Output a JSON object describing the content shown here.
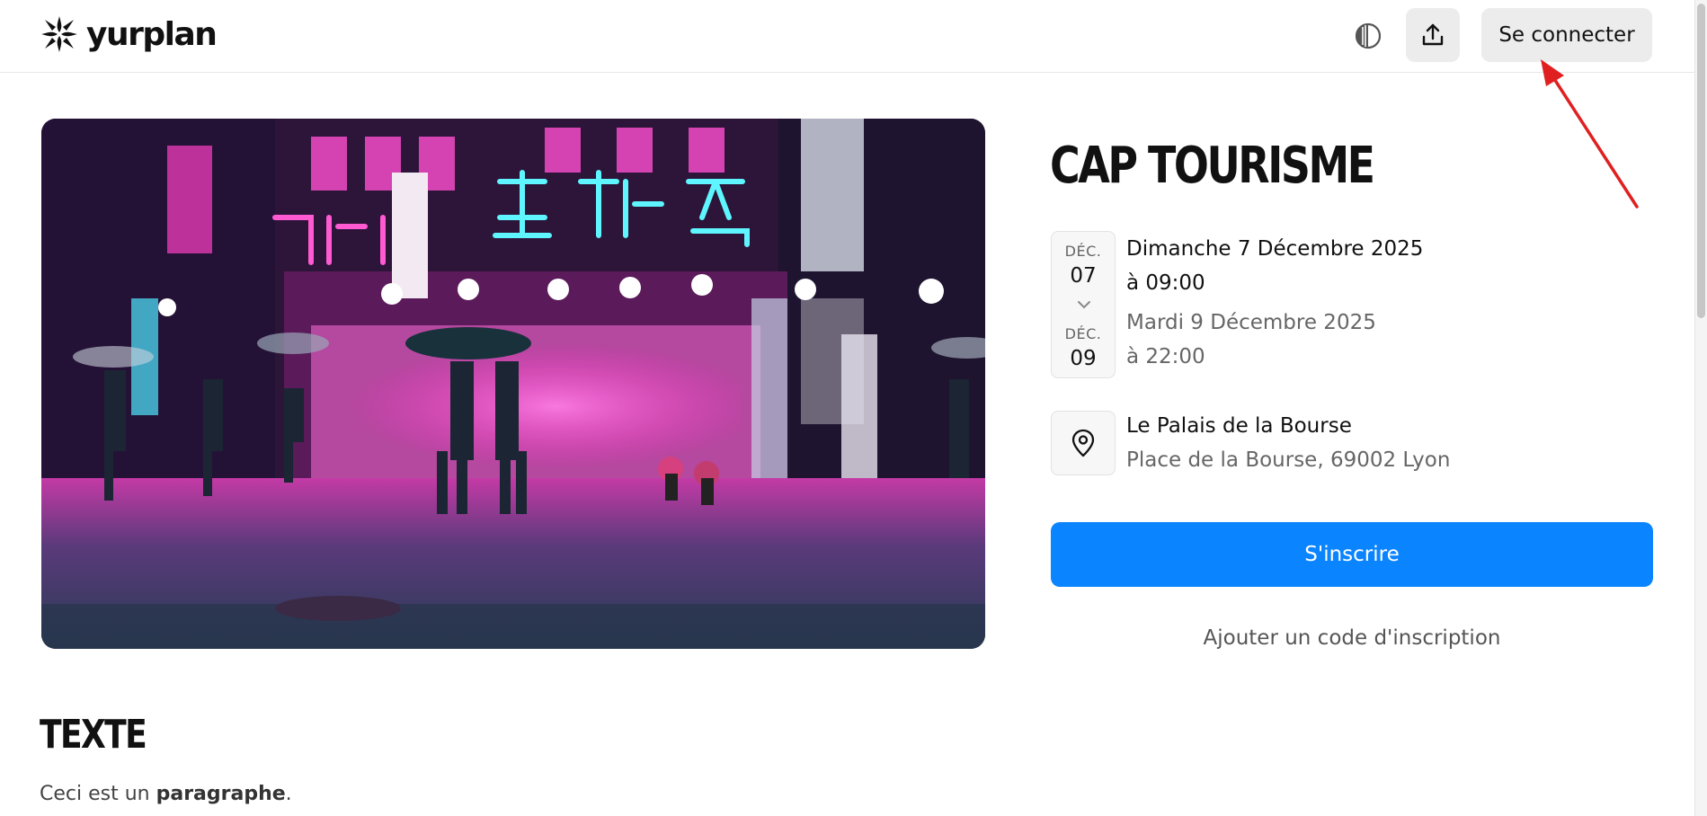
{
  "header": {
    "brand": "yurplan",
    "theme_icon": "contrast-icon",
    "share_icon": "upload-share-icon",
    "login_label": "Se connecter"
  },
  "event": {
    "title": "CAP TOURISME",
    "start": {
      "month": "DÉC.",
      "day": "07",
      "date_text": "Dimanche 7 Décembre 2025",
      "time_text": "à 09:00"
    },
    "end": {
      "month": "DÉC.",
      "day": "09",
      "date_text": "Mardi 9 Décembre 2025",
      "time_text": "à 22:00"
    },
    "location": {
      "name": "Le Palais de la Bourse",
      "address": "Place de la Bourse, 69002 Lyon",
      "icon": "map-pin-icon"
    },
    "register_label": "S'inscrire",
    "code_label": "Ajouter un code d'inscription"
  },
  "content": {
    "section_title": "TEXTE",
    "paragraph_plain": "Ceci est un ",
    "paragraph_bold": "paragraphe",
    "paragraph_end": "."
  },
  "colors": {
    "accent": "#0a84ff",
    "annotation": "#e02020"
  }
}
